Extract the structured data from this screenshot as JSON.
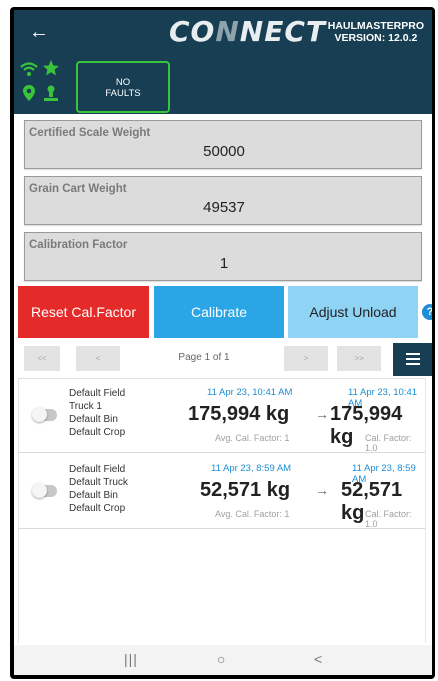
{
  "header": {
    "title_prefix": "CO",
    "title_highlight": "N",
    "title_suffix": "NECT",
    "version_line1": "HAULMASTERPRO",
    "version_line2": "VERSION: 12.0.2"
  },
  "status": {
    "faults_line1": "NO",
    "faults_line2": "FAULTS",
    "colors": {
      "ok": "#39c43b"
    }
  },
  "fields": {
    "certified_label": "Certified Scale Weight",
    "certified_value": "50000",
    "cart_label": "Grain Cart Weight",
    "cart_value": "49537",
    "factor_label": "Calibration Factor",
    "factor_value": "1"
  },
  "buttons": {
    "reset": "Reset Cal.Factor",
    "calibrate": "Calibrate",
    "adjust": "Adjust Unload",
    "help": "?"
  },
  "pager": {
    "first": "<<",
    "prev": "<",
    "info": "Page 1 of 1",
    "next": ">",
    "last": ">>"
  },
  "records": [
    {
      "field": "Default Field",
      "truck": "Truck 1",
      "bin": "Default Bin",
      "crop": "Default Crop",
      "left_time": "11 Apr 23, 10:41 AM",
      "left_weight": "175,994 kg",
      "left_factor": "Avg. Cal. Factor: 1",
      "right_time": "11 Apr 23, 10:41 AM",
      "right_weight": "175,994 kg",
      "right_factor": "Cal. Factor: 1.0",
      "arrow": "→"
    },
    {
      "field": "Default Field",
      "truck": "Default Truck",
      "bin": "Default Bin",
      "crop": "Default Crop",
      "left_time": "11 Apr 23, 8:59 AM",
      "left_weight": "52,571 kg",
      "left_factor": "Avg. Cal. Factor: 1",
      "right_time": "11 Apr 23, 8:59 AM",
      "right_weight": "52,571 kg",
      "right_factor": "Cal. Factor: 1.0",
      "arrow": "→"
    }
  ],
  "navbar": {
    "recents": "|||",
    "home": "○",
    "back": "<"
  },
  "colors": {
    "header": "#173e52",
    "reset": "#e52a2a",
    "calibrate": "#2aa6e6",
    "adjust": "#8fd3f5",
    "timestamp": "#1c8dd6"
  }
}
